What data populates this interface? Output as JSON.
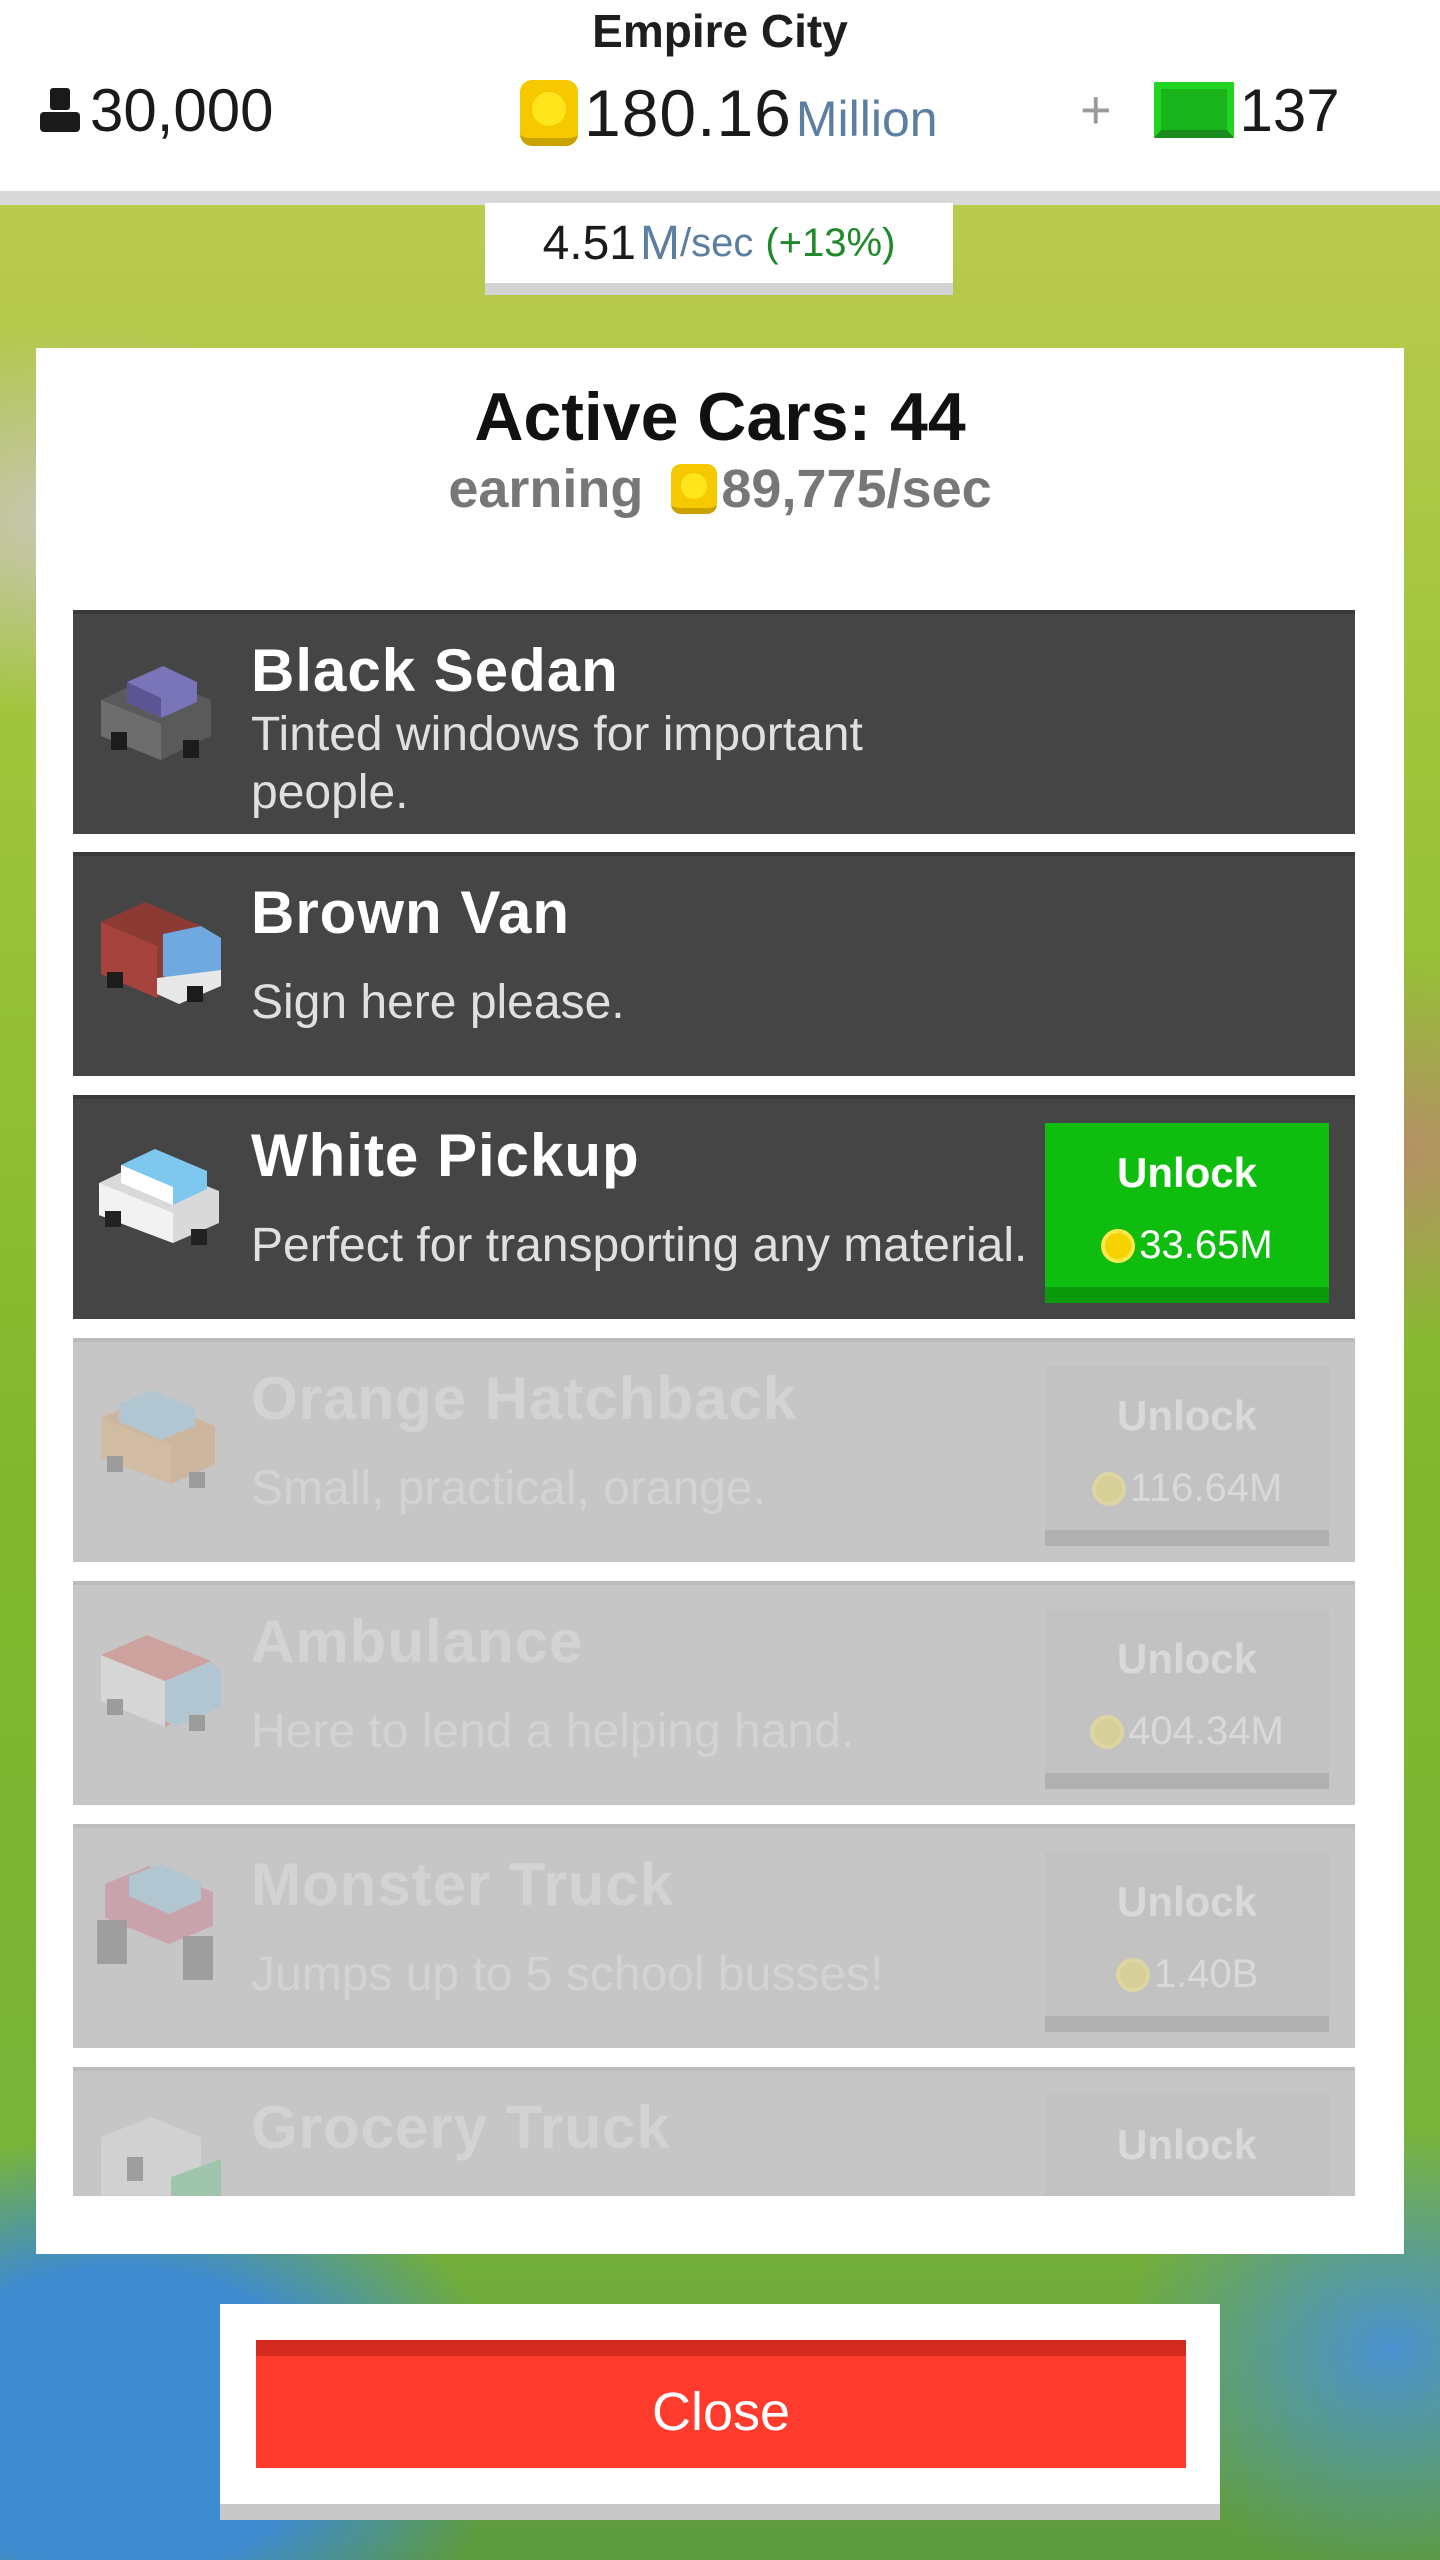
{
  "header": {
    "city_name": "Empire City",
    "population": "30,000",
    "coins_amount": "180.16",
    "coins_unit": "Million",
    "cash_plus": "+",
    "cash_amount": "137",
    "rate_value": "4.51",
    "rate_unit": "M",
    "rate_suffix": "/sec",
    "rate_bonus": "(+13%)"
  },
  "panel": {
    "title": "Active Cars: 44",
    "earning_label": "earning",
    "earning_value": "89,775/sec"
  },
  "cars": [
    {
      "name": "Black Sedan",
      "desc": "Tinted windows for important people.",
      "state": "owned"
    },
    {
      "name": "Brown Van",
      "desc": "Sign here please.",
      "state": "owned"
    },
    {
      "name": "White Pickup",
      "desc": "Perfect for transporting any material.",
      "state": "available",
      "unlock_label": "Unlock",
      "price": "33.65M"
    },
    {
      "name": "Orange Hatchback",
      "desc": "Small, practical, orange.",
      "state": "locked",
      "unlock_label": "Unlock",
      "price": "116.64M"
    },
    {
      "name": "Ambulance",
      "desc": "Here to lend a helping hand.",
      "state": "locked",
      "unlock_label": "Unlock",
      "price": "404.34M"
    },
    {
      "name": "Monster Truck",
      "desc": "Jumps up to 5 school busses!",
      "state": "locked",
      "unlock_label": "Unlock",
      "price": "1.40B"
    },
    {
      "name": "Grocery Truck",
      "desc": "",
      "state": "locked",
      "unlock_label": "Unlock",
      "price": ""
    }
  ],
  "close_label": "Close",
  "colors": {
    "unlock_green": "#0fbd0f",
    "close_red": "#ff3b2e",
    "coin_gold": "#f5c800",
    "row_dark": "#454545",
    "row_locked": "#c6c6c6"
  },
  "icons": {
    "population": "person-icon",
    "coins": "coin-icon",
    "cash": "cash-icon"
  }
}
